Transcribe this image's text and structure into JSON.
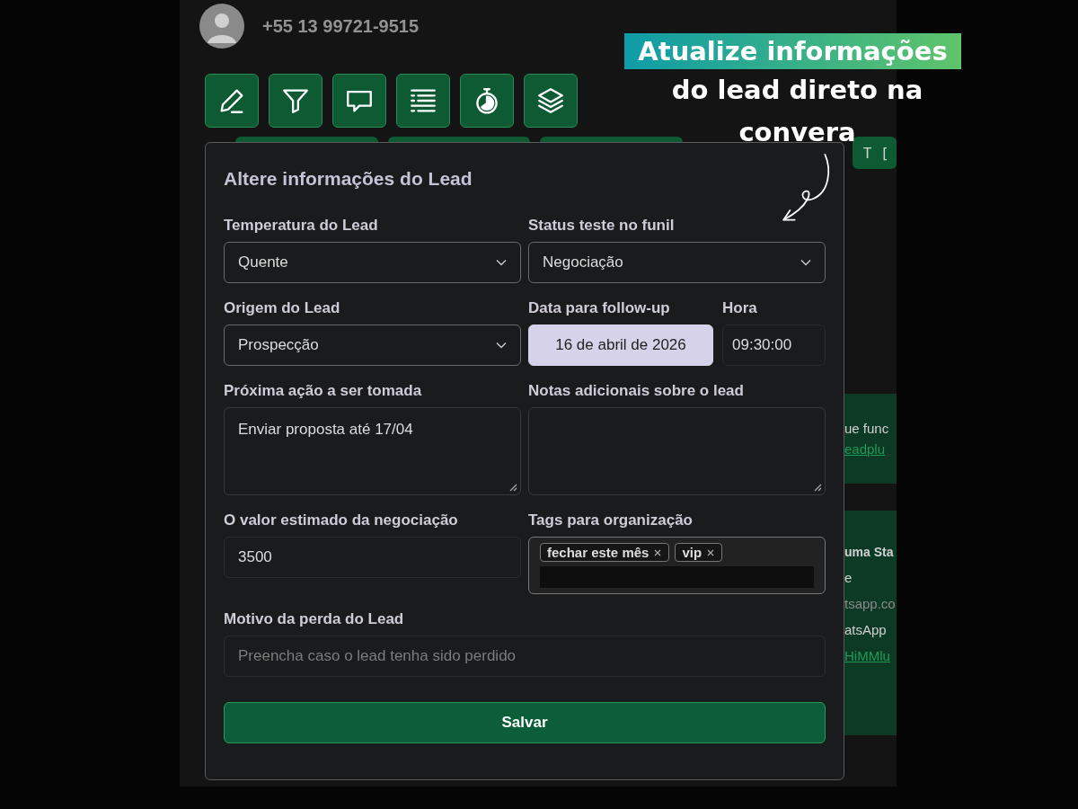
{
  "contact": {
    "phone": "+55 13 99721-9515"
  },
  "toolbar": [
    {
      "kind": "pencil"
    },
    {
      "kind": "funnel"
    },
    {
      "kind": "chat"
    },
    {
      "kind": "list"
    },
    {
      "kind": "timer"
    },
    {
      "kind": "layers"
    }
  ],
  "chip_label": "T [",
  "messages": [
    {
      "lines": [
        {
          "kind": "text",
          "text": "ue func"
        },
        {
          "kind": "link",
          "text": "eadplu"
        }
      ]
    },
    {
      "lines": [
        {
          "kind": "bold",
          "text": "uma Sta"
        },
        {
          "kind": "text",
          "text": "e"
        },
        {
          "kind": "muted",
          "text": "tsapp.co"
        },
        {
          "kind": "text",
          "text": "atsApp"
        },
        {
          "kind": "link",
          "text": "HiMMlu"
        }
      ]
    }
  ],
  "callout": {
    "headline": "Atualize informações",
    "lines": [
      "do lead direto na",
      "convera"
    ]
  },
  "form": {
    "title": "Altere informações do Lead",
    "rows": [
      [
        [
          {
            "kind": "select",
            "label": "Temperatura do Lead",
            "value": "Quente"
          }
        ],
        [
          {
            "kind": "select",
            "label": "Status teste no funil",
            "value": "Negociação"
          }
        ]
      ],
      [
        [
          {
            "kind": "select",
            "label": "Origem do Lead",
            "value": "Prospecção"
          }
        ],
        [
          {
            "kind": "date",
            "label": "Data para follow-up",
            "value": "16 de abril de 2026"
          },
          {
            "kind": "time",
            "label": "Hora",
            "value": "09:30:00"
          }
        ]
      ],
      [
        [
          {
            "kind": "textarea",
            "label": "Próxima ação a ser tomada",
            "value": "Enviar proposta até 17/04"
          }
        ],
        [
          {
            "kind": "textarea",
            "label": "Notas adicionais sobre o lead"
          }
        ]
      ],
      [
        [
          {
            "kind": "input",
            "label": "O valor estimado da negociação",
            "value": "3500"
          }
        ],
        [
          {
            "kind": "tags",
            "label": "Tags para organização",
            "tags": [
              "fechar este mês",
              "vip"
            ]
          }
        ]
      ],
      [
        [
          {
            "kind": "input",
            "label": "Motivo da perda do Lead",
            "placeholder": "Preencha caso o lead tenha sido perdido"
          }
        ]
      ]
    ],
    "submit": "Salvar"
  }
}
